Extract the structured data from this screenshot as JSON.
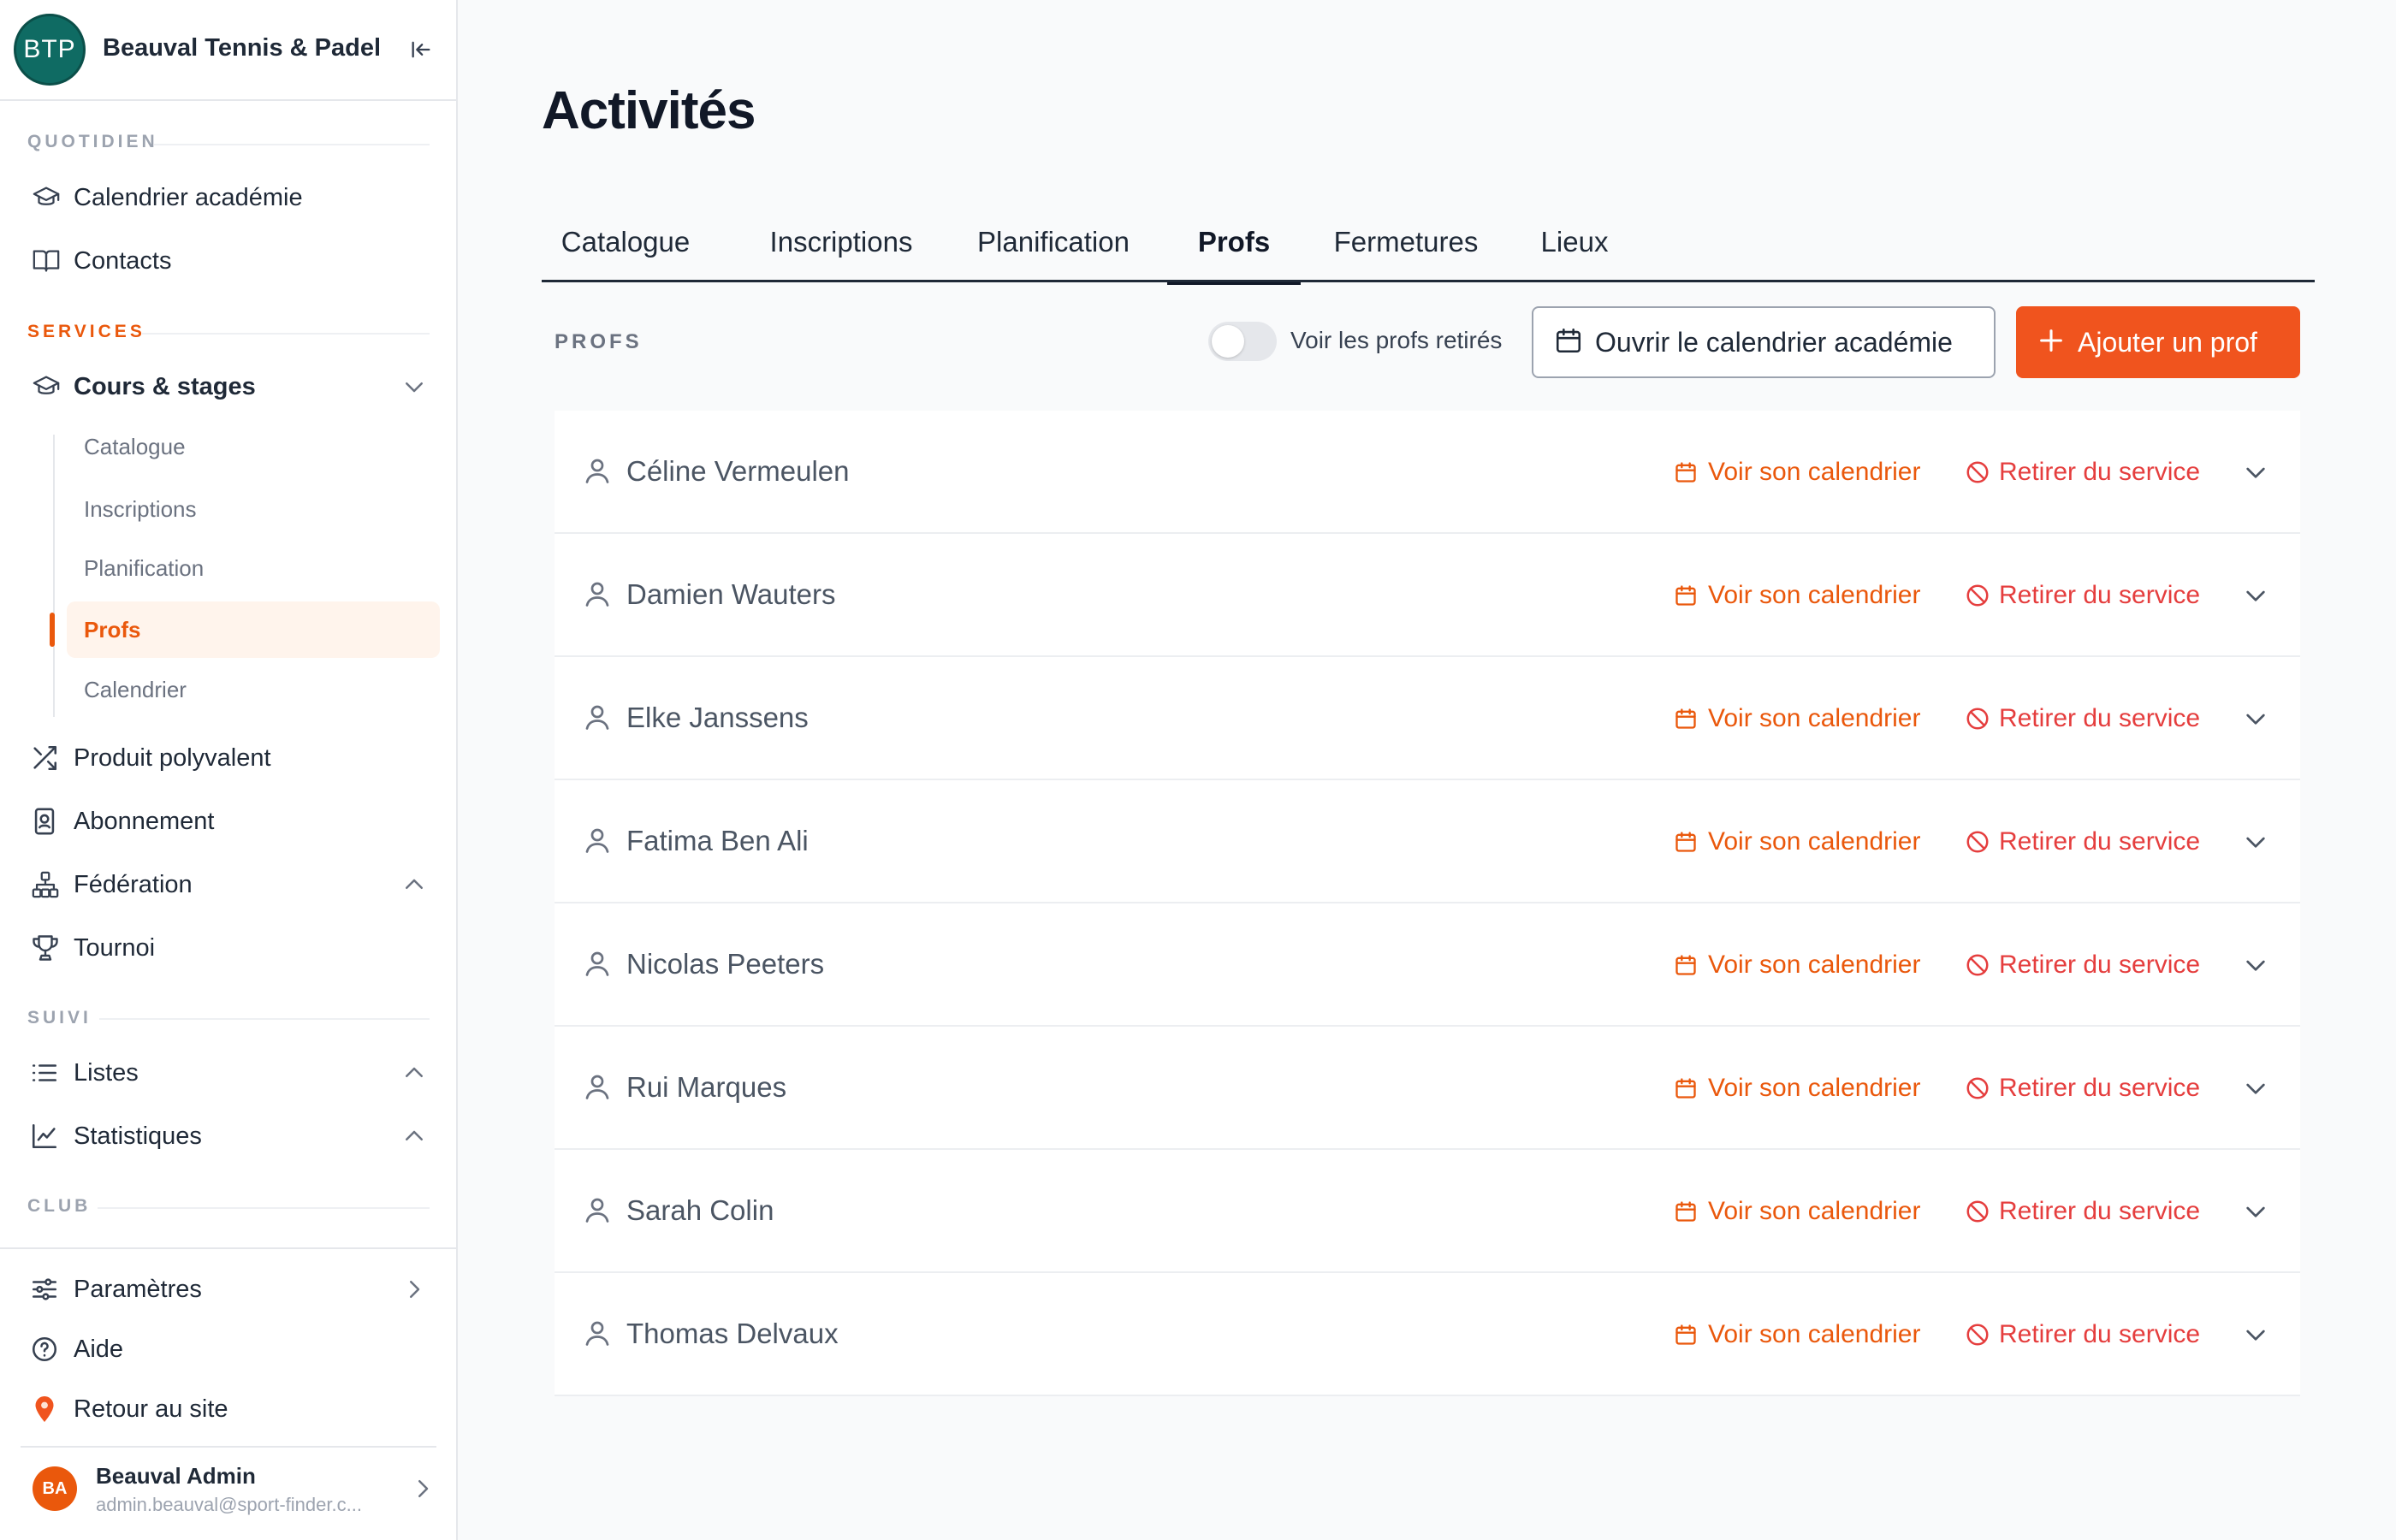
{
  "sidebar": {
    "logo_text": "BTP",
    "club_name": "Beauval Tennis & Padel",
    "sections": {
      "quotidien": "QUOTIDIEN",
      "services": "SERVICES",
      "suivi": "SUIVI",
      "club": "CLUB"
    },
    "items": {
      "calendrier_academie": "Calendrier académie",
      "contacts": "Contacts",
      "cours_stages": "Cours & stages",
      "produit_polyvalent": "Produit polyvalent",
      "abonnement": "Abonnement",
      "federation": "Fédération",
      "tournoi": "Tournoi",
      "listes": "Listes",
      "statistiques": "Statistiques",
      "parametres": "Paramètres",
      "aide": "Aide",
      "retour_site": "Retour au site"
    },
    "sub_items": {
      "catalogue": "Catalogue",
      "inscriptions": "Inscriptions",
      "planification": "Planification",
      "profs": "Profs",
      "calendrier": "Calendrier"
    },
    "user": {
      "initials": "BA",
      "name": "Beauval Admin",
      "email": "admin.beauval@sport-finder.c..."
    }
  },
  "main": {
    "title": "Activités",
    "tabs": {
      "catalogue": "Catalogue",
      "inscriptions": "Inscriptions",
      "planification": "Planification",
      "profs": "Profs",
      "fermetures": "Fermetures",
      "lieux": "Lieux"
    },
    "toolbar": {
      "section_label": "PROFS",
      "toggle_label": "Voir les profs retirés",
      "toggle_on": false,
      "open_calendar": "Ouvrir le calendrier académie",
      "add_prof": "Ajouter un prof"
    },
    "row_actions": {
      "calendar": "Voir son calendrier",
      "retire": "Retirer du service"
    },
    "profs": [
      "Céline Vermeulen",
      "Damien Wauters",
      "Elke Janssens",
      "Fatima Ben Ali",
      "Nicolas Peeters",
      "Rui Marques",
      "Sarah Colin",
      "Thomas Delvaux"
    ]
  },
  "colors": {
    "accent": "#f0541e",
    "danger": "#e53e3e",
    "logo_bg": "#0f6b63"
  }
}
